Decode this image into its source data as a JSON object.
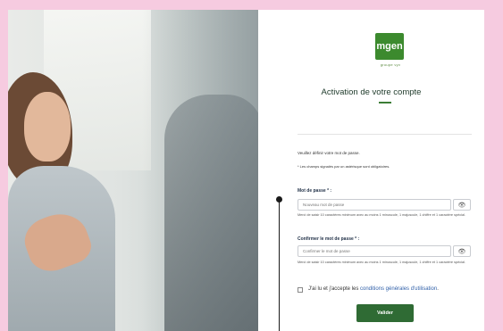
{
  "brand": {
    "logo_text": "mgen",
    "logo_sub": "groupe vyv",
    "accent": "#2f6b34"
  },
  "header": {
    "title": "Activation de votre compte"
  },
  "form": {
    "intro": "Veuillez définir votre mot de passe.",
    "required_note": "* Les champs signalés par un astérisque sont obligatoires.",
    "password": {
      "label": "Mot de passe * :",
      "placeholder": "Nouveau mot de passe",
      "hint": "Merci de saisir 10 caractères minimum avec au moins 1 minuscule, 1 majuscule, 1 chiffre et 1 caractère spécial."
    },
    "confirm": {
      "label": "Confirmer le mot de passe * :",
      "placeholder": "Confirmer le mot de passe",
      "hint": "Merci de saisir 10 caractères minimum avec au moins 1 minuscule, 1 majuscule, 1 chiffre et 1 caractère spécial."
    },
    "terms": {
      "prefix": "J'ai lu et j'accepte les ",
      "link": "conditions générales d'utilisation",
      "suffix": ".",
      "checked": false
    },
    "submit_label": "Valider"
  }
}
